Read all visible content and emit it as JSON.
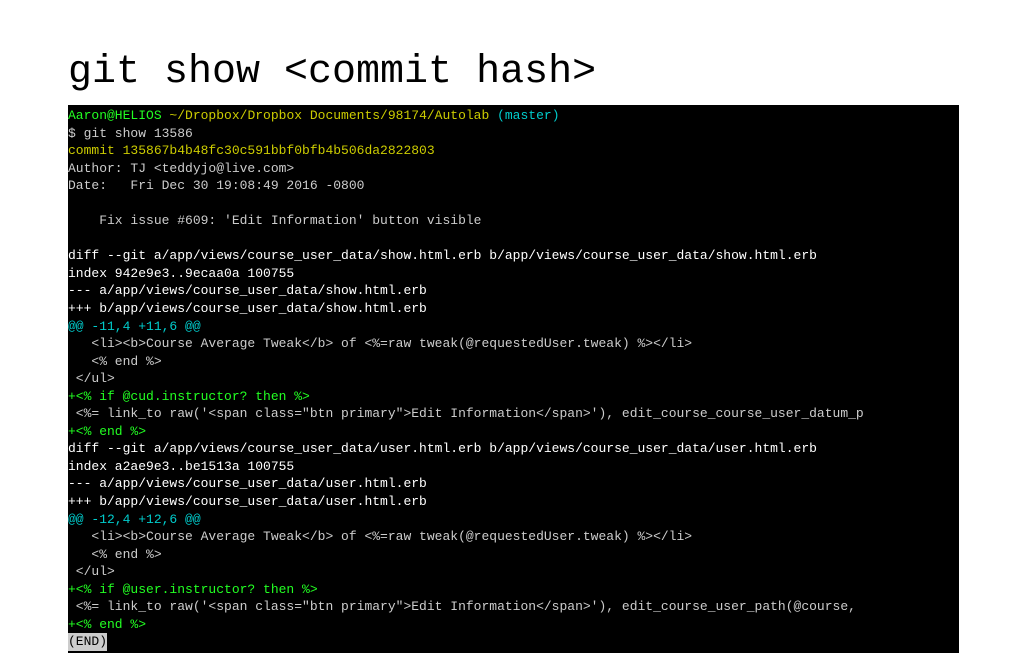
{
  "title": "git show <commit hash>",
  "terminal": {
    "prompt_user": "Aaron@HELIOS",
    "prompt_path": " ~/Dropbox/Dropbox Documents/98174/Autolab",
    "prompt_branch": " (master)",
    "command": "$ git show 13586",
    "commit": "commit 135867b4b48fc30c591bbf0bfb4b506da2822803",
    "author": "Author: TJ <teddyjo@live.com>",
    "date": "Date:   Fri Dec 30 19:08:49 2016 -0800",
    "msg": "    Fix issue #609: 'Edit Information' button visible",
    "diff1_head": "diff --git a/app/views/course_user_data/show.html.erb b/app/views/course_user_data/show.html.erb",
    "diff1_index": "index 942e9e3..9ecaa0a 100755",
    "diff1_minus": "--- a/app/views/course_user_data/show.html.erb",
    "diff1_plus": "+++ b/app/views/course_user_data/show.html.erb",
    "diff1_hunk": "@@ -11,4 +11,6 @@",
    "diff1_ctx1": "   <li><b>Course Average Tweak</b> of <%=raw tweak(@requestedUser.tweak) %></li>",
    "diff1_ctx2": "   <% end %>",
    "diff1_ctx3": " </ul>",
    "diff1_add1": "+<% if @cud.instructor? then %>",
    "diff1_ctx4": " <%= link_to raw('<span class=\"btn primary\">Edit Information</span>'), edit_course_course_user_datum_p",
    "diff1_add2": "+<% end %>",
    "diff2_head": "diff --git a/app/views/course_user_data/user.html.erb b/app/views/course_user_data/user.html.erb",
    "diff2_index": "index a2ae9e3..be1513a 100755",
    "diff2_minus": "--- a/app/views/course_user_data/user.html.erb",
    "diff2_plus": "+++ b/app/views/course_user_data/user.html.erb",
    "diff2_hunk": "@@ -12,4 +12,6 @@",
    "diff2_ctx1": "   <li><b>Course Average Tweak</b> of <%=raw tweak(@requestedUser.tweak) %></li>",
    "diff2_ctx2": "   <% end %>",
    "diff2_ctx3": " </ul>",
    "diff2_add1": "+<% if @user.instructor? then %>",
    "diff2_ctx4": " <%= link_to raw('<span class=\"btn primary\">Edit Information</span>'), edit_course_user_path(@course,",
    "diff2_add2": "+<% end %>",
    "pager_end": "(END)"
  }
}
